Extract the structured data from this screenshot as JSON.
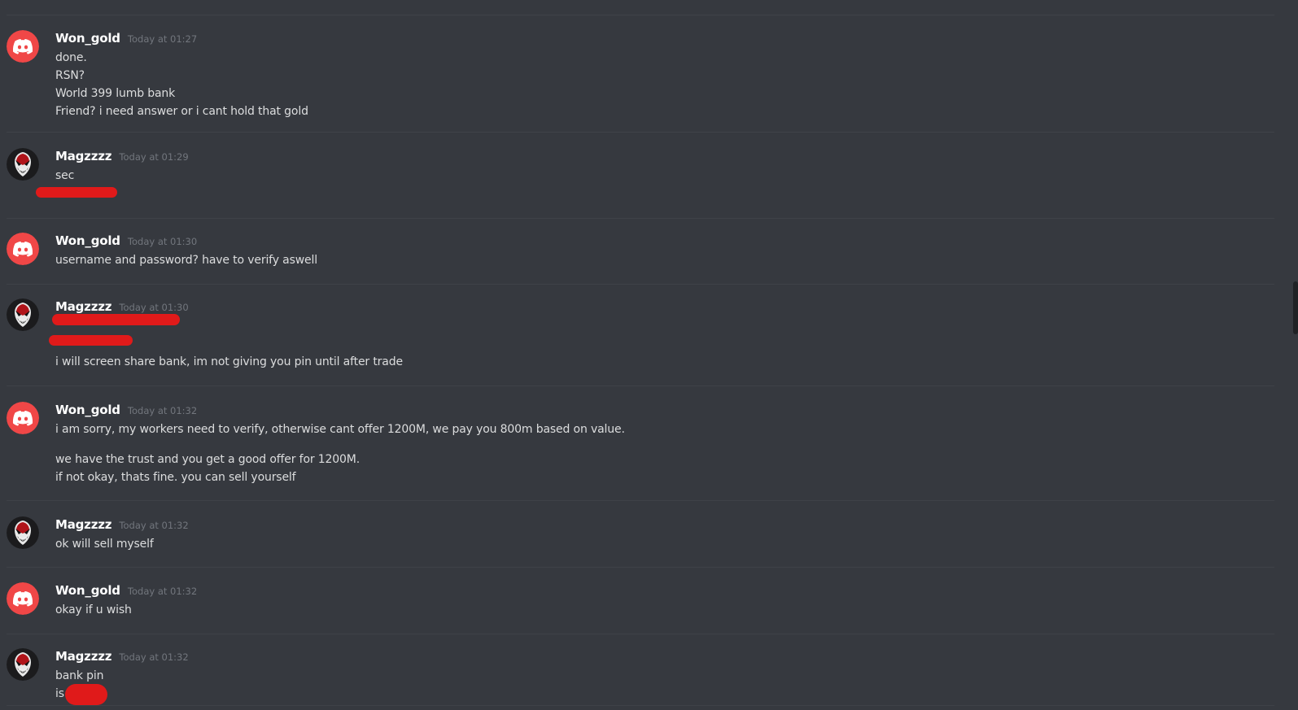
{
  "brand": {
    "won_avatar_color": "#f04747",
    "redaction_color": "#e01a1a"
  },
  "messages": [
    {
      "author": "Won_gold",
      "timestamp": "Today at 01:27",
      "avatar_icon": "discord-logo-icon",
      "lines": [
        "done.",
        "RSN?",
        "World 399 lumb bank",
        "Friend? i need answer or i cant hold that gold"
      ]
    },
    {
      "author": "Magzzzz",
      "timestamp": "Today at 01:29",
      "avatar_icon": "venom-mask-icon",
      "lines": [
        "sec",
        ""
      ]
    },
    {
      "author": "Won_gold",
      "timestamp": "Today at 01:30",
      "avatar_icon": "discord-logo-icon",
      "lines": [
        "username and password? have to verify aswell"
      ]
    },
    {
      "author": "Magzzzz",
      "timestamp": "Today at 01:30",
      "avatar_icon": "venom-mask-icon",
      "lines": [
        "",
        "",
        "i will screen share bank, im not giving you pin until after trade"
      ]
    },
    {
      "author": "Won_gold",
      "timestamp": "Today at 01:32",
      "avatar_icon": "discord-logo-icon",
      "lines": [
        "i am sorry, my workers need to verify, otherwise cant offer 1200M, we pay you 800m based on value.",
        "we have the trust and you get a good offer for 1200M.",
        "if not okay, thats fine. you can sell yourself"
      ]
    },
    {
      "author": "Magzzzz",
      "timestamp": "Today at 01:32",
      "avatar_icon": "venom-mask-icon",
      "lines": [
        "ok will sell myself"
      ]
    },
    {
      "author": "Won_gold",
      "timestamp": "Today at 01:32",
      "avatar_icon": "discord-logo-icon",
      "lines": [
        "okay if u wish"
      ]
    },
    {
      "author": "Magzzzz",
      "timestamp": "Today at 01:32",
      "avatar_icon": "venom-mask-icon",
      "lines": [
        "bank pin",
        "is"
      ]
    }
  ]
}
